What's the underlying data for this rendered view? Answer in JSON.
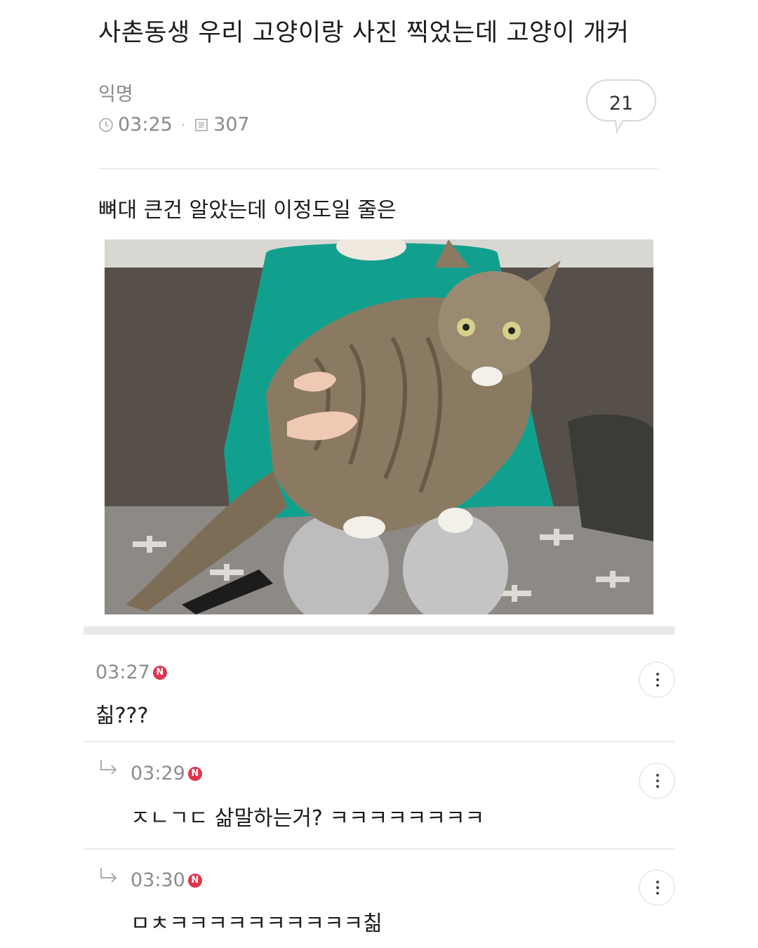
{
  "post": {
    "title": "사촌동생 우리 고양이랑 사진 찍었는데 고양이 개커",
    "author": "익명",
    "time": "03:25",
    "views": "307",
    "comment_count": "21",
    "body": "뼈대 큰건 알았는데 이정도일 줄은"
  },
  "comments": [
    {
      "time": "03:27",
      "badge": "N",
      "text": "칢???"
    },
    {
      "time": "03:29",
      "badge": "N",
      "text": "ㅈㄴㄱㄷ 삶말하는거? ㅋㅋㅋㅋㅋㅋㅋㅋ",
      "reply": true
    },
    {
      "time": "03:30",
      "badge": "N",
      "text": "ㅁㅊㅋㅋㅋㅋㅋㅋㅋㅋㅋㅋ칢",
      "reply": true
    }
  ],
  "icons": {
    "clock": "clock-icon",
    "views": "document-icon",
    "comment": "speech-bubble-icon",
    "more": "more-vertical-icon",
    "reply": "reply-arrow-icon"
  },
  "colors": {
    "new_badge": "#e0344b",
    "meta_text": "#8a8a8a"
  }
}
